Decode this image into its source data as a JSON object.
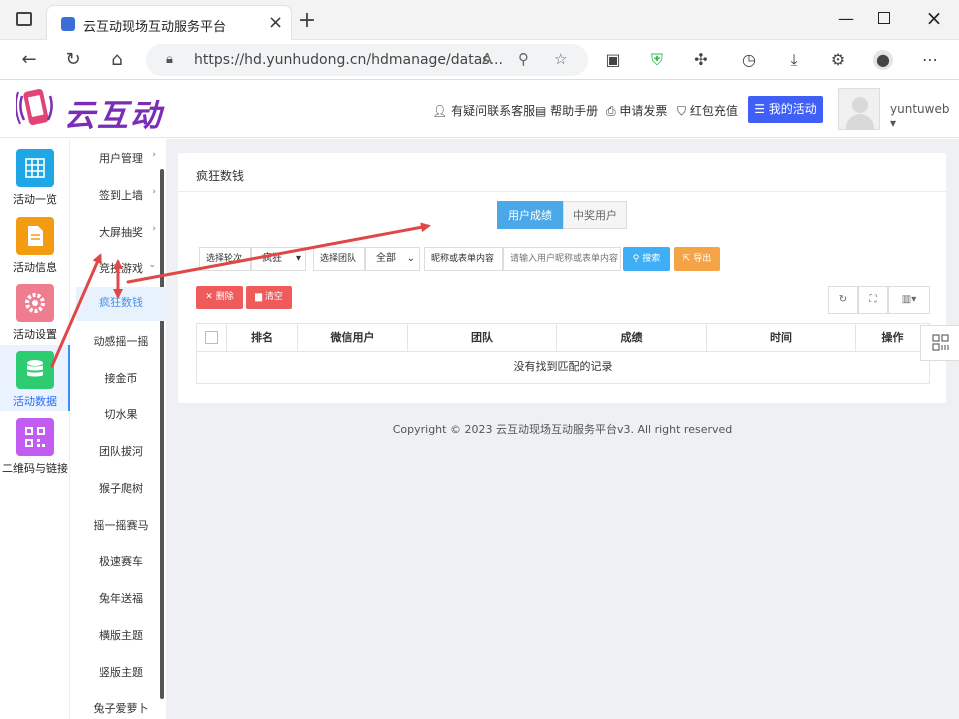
{
  "browser": {
    "tab_title": "云互动现场互动服务平台",
    "url": "https://hd.yunhudong.cn/hdmanage/datas..."
  },
  "header": {
    "logo_text": "云互动",
    "links": [
      {
        "icon": "person-add-icon",
        "label": "有疑问联系客服"
      },
      {
        "icon": "book-icon",
        "label": "帮助手册"
      },
      {
        "icon": "print-icon",
        "label": "申请发票"
      },
      {
        "icon": "shield-icon",
        "label": "红包充值"
      }
    ],
    "my_activity": "我的活动",
    "username": "yuntuweb"
  },
  "sidebar_main": [
    {
      "label": "活动一览",
      "icon": "grid-icon",
      "color": "#1ea7e4"
    },
    {
      "label": "活动信息",
      "icon": "document-icon",
      "color": "#f39c12"
    },
    {
      "label": "活动设置",
      "icon": "gear-icon",
      "color": "#f07c8f"
    },
    {
      "label": "活动数据",
      "icon": "database-icon",
      "color": "#2ecc71",
      "active": true
    },
    {
      "label": "二维码与链接",
      "icon": "qrcode-icon",
      "color": "#c35cf0"
    }
  ],
  "sidebar_sub": [
    {
      "label": "用户管理",
      "chevron": "›"
    },
    {
      "label": "签到上墙",
      "chevron": "›"
    },
    {
      "label": "大屏抽奖",
      "chevron": "›"
    },
    {
      "label": "竞技游戏",
      "chevron": "⌄"
    },
    {
      "label": "疯狂数钱",
      "active": true
    },
    {
      "label": "动感摇一摇"
    },
    {
      "label": "接金币"
    },
    {
      "label": "切水果"
    },
    {
      "label": "团队拔河"
    },
    {
      "label": "猴子爬树"
    },
    {
      "label": "摇一摇赛马"
    },
    {
      "label": "极速赛车"
    },
    {
      "label": "兔年送福"
    },
    {
      "label": "横版主题"
    },
    {
      "label": "竖版主题"
    },
    {
      "label": "兔子爱萝卜"
    }
  ],
  "panel": {
    "title": "疯狂数钱",
    "tabs": [
      "用户成绩",
      "中奖用户"
    ],
    "filters": {
      "round_label": "选择轮次",
      "round_value": "疯狂",
      "team_label": "选择团队",
      "team_value": "全部",
      "search_label": "昵称或表单内容",
      "search_placeholder": "请输入用户昵称或表单内容",
      "search_button": "搜索",
      "export_button": "导出"
    },
    "actions": {
      "delete": "删除",
      "clear": "清空"
    },
    "table": {
      "columns": [
        "排名",
        "微信用户",
        "团队",
        "成绩",
        "时间",
        "操作"
      ],
      "empty_text": "没有找到匹配的记录"
    }
  },
  "footer": {
    "copyright": "Copyright © 2023 云互动现场互动服务平台v3. All right reserved"
  },
  "colors": {
    "accent_blue": "#3f5ff6",
    "tab_active": "#4aa8e8",
    "search": "#3eaef5",
    "export": "#f5a347",
    "danger": "#ef5a5a",
    "annotation_arrow": "#e04848"
  }
}
